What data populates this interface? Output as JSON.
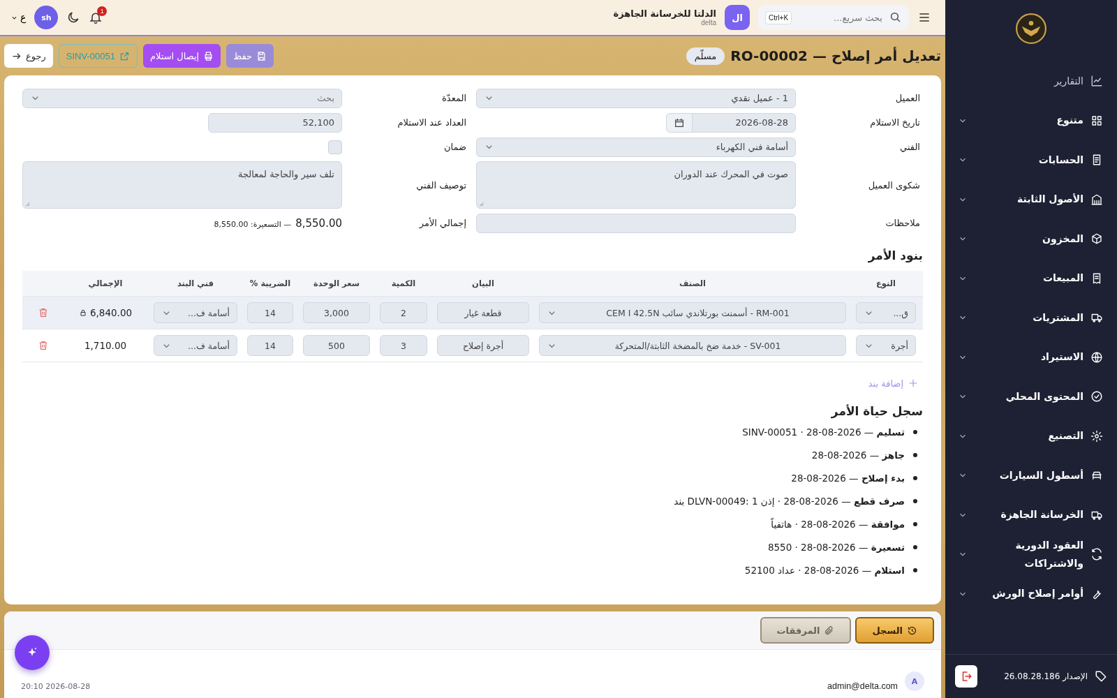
{
  "header": {
    "search": {
      "placeholder": "بحث سريع...",
      "shortcut": "Ctrl+K"
    },
    "org": {
      "initials": "ال",
      "name": "الدلتا للخرسانة الجاهزة",
      "subtitle": "delta"
    },
    "notifications": "1",
    "user_initials": "sh",
    "language": "ع"
  },
  "page": {
    "title": "تعديل أمر إصلاح — RO-00002",
    "status": "مسلّم",
    "buttons": [
      {
        "kind": "save",
        "label": "حفظ"
      },
      {
        "kind": "print",
        "label": "إيصال استلام"
      },
      {
        "kind": "link",
        "label": "SINV-00051"
      },
      {
        "kind": "back",
        "label": "رجوع"
      }
    ]
  },
  "form": [
    {
      "label": "العميل",
      "kind": "select",
      "value": "1 - عميل نقدي"
    },
    {
      "label": "المعدّة",
      "kind": "select",
      "placeholder": "بحث"
    },
    {
      "label": "تاريخ الاستلام",
      "kind": "date",
      "value": "2026-08-28"
    },
    {
      "label": "العداد عند الاستلام",
      "kind": "number",
      "value": "52,100"
    },
    {
      "label": "الفني",
      "kind": "select",
      "value": "أسامة فني الكهرباء"
    },
    {
      "label": "ضمان",
      "kind": "checkbox",
      "checked": false
    },
    {
      "label": "شكوى العميل",
      "kind": "textarea",
      "value": "صوت في المحرك عند الدوران"
    },
    {
      "label": "توصيف الفني",
      "kind": "textarea",
      "value": "تلف سير والحاجة لمعالجة"
    },
    {
      "label": "ملاحظات",
      "kind": "text"
    },
    {
      "label": "إجمالي الأمر",
      "kind": "total",
      "value": "8,550.00",
      "note": "— التسعيرة: 8,550.00"
    }
  ],
  "items": {
    "title": "بنود الأمر",
    "columns": [
      "النوع",
      "الصنف",
      "البيان",
      "الكمية",
      "سعر الوحدة",
      "الضريبة %",
      "فني البند",
      "الإجمالي"
    ],
    "rows": [
      {
        "selected": true,
        "locked": true,
        "type": "ق...",
        "item": "RM-001 - أسمنت بورتلاندي سائب CEM I 42.5N",
        "description": "قطعة غيار",
        "quantity": "2",
        "unit_price": "3,000",
        "tax": "14",
        "technician": "أسامة ف...",
        "total": "6,840.00"
      },
      {
        "selected": false,
        "locked": false,
        "type": "أجرة",
        "item": "SV-001 - خدمة ضخ بالمضخة الثابتة/المتحركة",
        "description": "أجرة إصلاح",
        "quantity": "3",
        "unit_price": "500",
        "tax": "14",
        "technician": "أسامة ف...",
        "total": "1,710.00"
      }
    ],
    "add_label": "إضافة بند"
  },
  "lifecycle": {
    "title": "سجل حياة الأمر",
    "entries": [
      "**تسليم** — 2026-08-28 · SINV-00051",
      "**جاهز** — 2026-08-28",
      "**بدء إصلاح** — 2026-08-28",
      "**صرف قطع** — 2026-08-28 · إذن DLVN-00049: 1 بند",
      "**موافقة** — 2026-08-28 · هاتفياً",
      "**تسعيرة** — 2026-08-28 · 8550",
      "**استلام** — 2026-08-28 · عداد 52100"
    ]
  },
  "bottom_tabs": [
    {
      "label": "السجل",
      "selected": true
    },
    {
      "label": "المرفقات",
      "selected": false
    }
  ],
  "footer": {
    "avatar": "A",
    "user": "admin@delta.com",
    "timestamp": "2026-08-28 20:10"
  },
  "sidebar": {
    "items": [
      {
        "label": "التقارير",
        "expandable": false
      },
      {
        "label": "متنوع",
        "expandable": true
      },
      {
        "label": "الحسابات",
        "expandable": true
      },
      {
        "label": "الأصول الثابتة",
        "expandable": true
      },
      {
        "label": "المخزون",
        "expandable": true
      },
      {
        "label": "المبيعات",
        "expandable": true
      },
      {
        "label": "المشتريات",
        "expandable": true
      },
      {
        "label": "الاستيراد",
        "expandable": true
      },
      {
        "label": "المحتوى المحلي",
        "expandable": true
      },
      {
        "label": "التصنيع",
        "expandable": true
      },
      {
        "label": "أسطول السيارات",
        "expandable": true
      },
      {
        "label": "الخرسانة الجاهزة",
        "expandable": true
      },
      {
        "label": "العقود الدورية والاشتراكات",
        "expandable": true
      },
      {
        "label": "أوامر إصلاح الورش",
        "expandable": true
      }
    ],
    "version": "الإصدار 26.08.28.186"
  }
}
